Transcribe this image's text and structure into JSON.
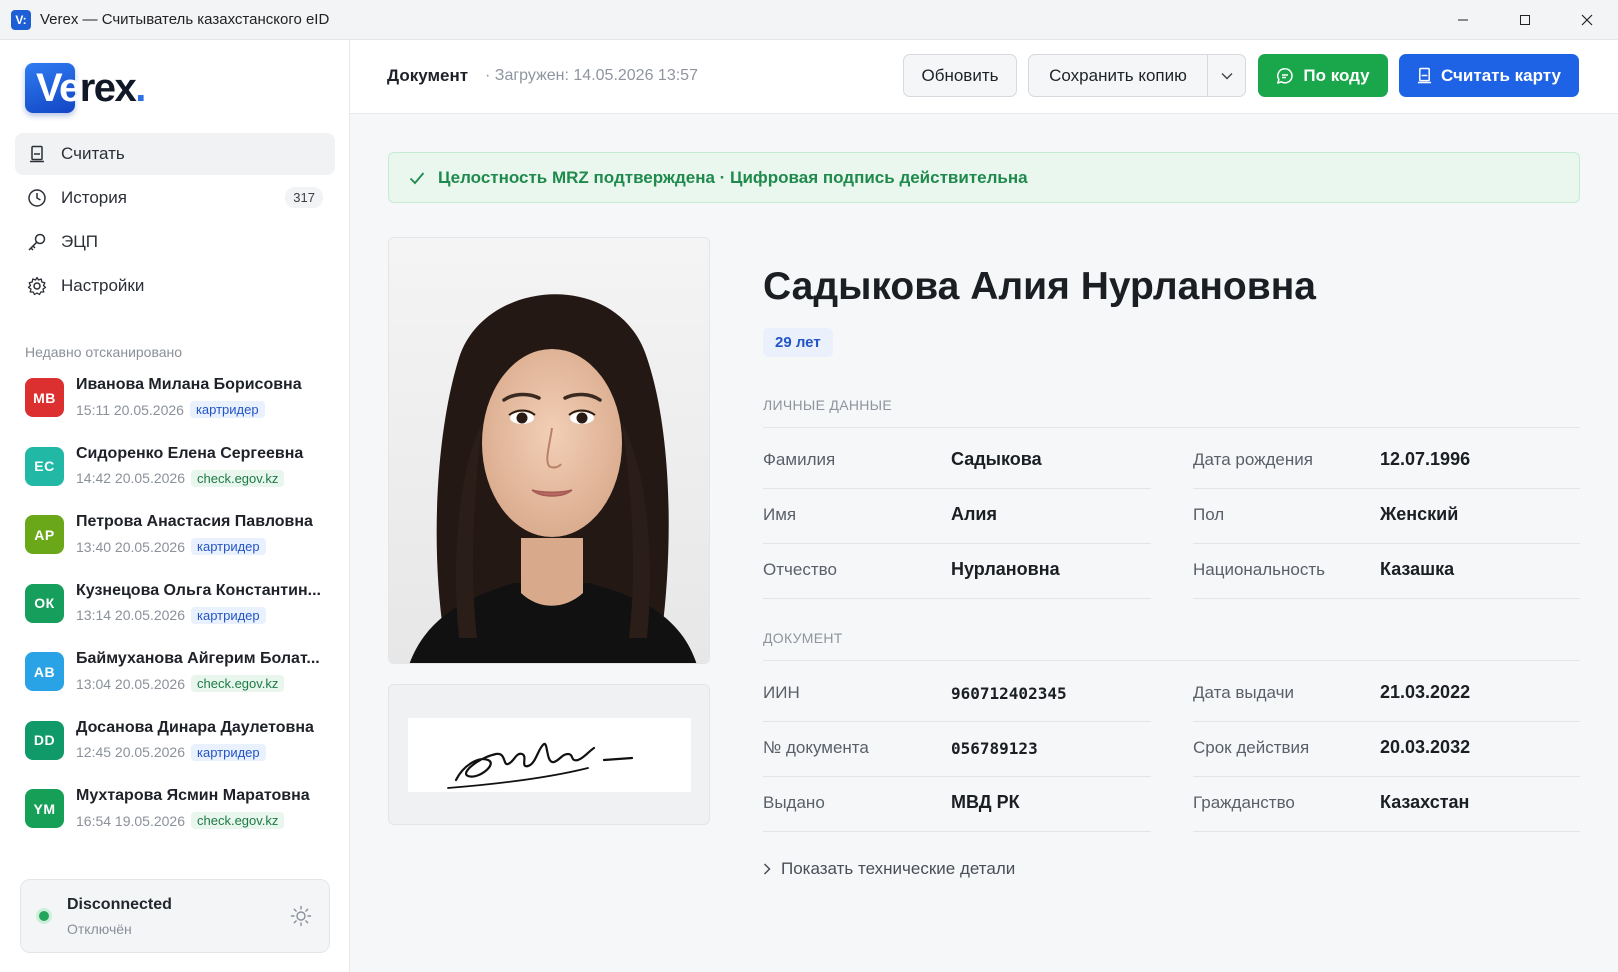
{
  "window": {
    "app_glyph": "V:",
    "title": "Verex — Считыватель казахстанского eID"
  },
  "logo": {
    "text_part1": "Ve",
    "text_part2": "rex",
    "dot": "."
  },
  "nav": {
    "items": [
      {
        "label": "Считать",
        "icon": "card-reader-icon"
      },
      {
        "label": "История",
        "icon": "clock-icon",
        "count": "317"
      },
      {
        "label": "ЭЦП",
        "icon": "key-icon"
      },
      {
        "label": "Настройки",
        "icon": "gear-icon"
      }
    ]
  },
  "recent": {
    "title": "Недавно отсканировано",
    "items": [
      {
        "initials": "МВ",
        "color": "#dc2f2f",
        "name": "Иванова Милана Борисовна",
        "time": "15:11 20.05.2026",
        "source": "картридер"
      },
      {
        "initials": "ЕС",
        "color": "#22b8a6",
        "name": "Сидоренко Елена Сергеевна",
        "time": "14:42 20.05.2026",
        "source": "check.egov.kz"
      },
      {
        "initials": "АР",
        "color": "#6aa719",
        "name": "Петрова Анастасия Павловна",
        "time": "13:40 20.05.2026",
        "source": "картридер"
      },
      {
        "initials": "ОК",
        "color": "#169f5c",
        "name": "Кузнецова Ольга Константин...",
        "time": "13:14 20.05.2026",
        "source": "картридер"
      },
      {
        "initials": "АВ",
        "color": "#2aa3e6",
        "name": "Баймуханова Айгерим Болат...",
        "time": "13:04 20.05.2026",
        "source": "check.egov.kz"
      },
      {
        "initials": "DD",
        "color": "#109a6a",
        "name": "Досанова Динара Даулетовна",
        "time": "12:45 20.05.2026",
        "source": "картридер"
      },
      {
        "initials": "YM",
        "color": "#16a057",
        "name": "Мухтарова Ясмин Маратовна",
        "time": "16:54 19.05.2026",
        "source": "check.egov.kz"
      }
    ]
  },
  "connection": {
    "title": "Disconnected",
    "subtitle": "Отключён",
    "status_color": "#22a55a"
  },
  "topbar": {
    "doc_title": "Документ",
    "loaded": "· Загружен: 14.05.2026 13:57",
    "refresh_label": "Обновить",
    "save_label": "Сохранить копию",
    "code_label": "По коду",
    "read_label": "Считать карту"
  },
  "banner": {
    "text": "Целостность MRZ подтверждена · Цифровая подпись действительна",
    "color": "#1f8a4c"
  },
  "person": {
    "full_name": "Садыкова Алия Нурлановна",
    "age": "29 лет"
  },
  "personal": {
    "title": "ЛИЧНЫЕ ДАННЫЕ",
    "left": [
      {
        "label": "Фамилия",
        "value": "Садыкова"
      },
      {
        "label": "Имя",
        "value": "Алия"
      },
      {
        "label": "Отчество",
        "value": "Нурлановна"
      }
    ],
    "right": [
      {
        "label": "Дата рождения",
        "value": "12.07.1996"
      },
      {
        "label": "Пол",
        "value": "Женский"
      },
      {
        "label": "Национальность",
        "value": "Казашка"
      }
    ]
  },
  "document": {
    "title": "ДОКУМЕНТ",
    "left": [
      {
        "label": "ИИН",
        "value": "960712402345"
      },
      {
        "label": "№ документа",
        "value": "056789123"
      },
      {
        "label": "Выдано",
        "value": "МВД РК"
      }
    ],
    "right": [
      {
        "label": "Дата выдачи",
        "value": "21.03.2022"
      },
      {
        "label": "Срок действия",
        "value": "20.03.2032"
      },
      {
        "label": "Гражданство",
        "value": "Казахстан"
      }
    ]
  },
  "tech_toggle": "Показать технические детали"
}
